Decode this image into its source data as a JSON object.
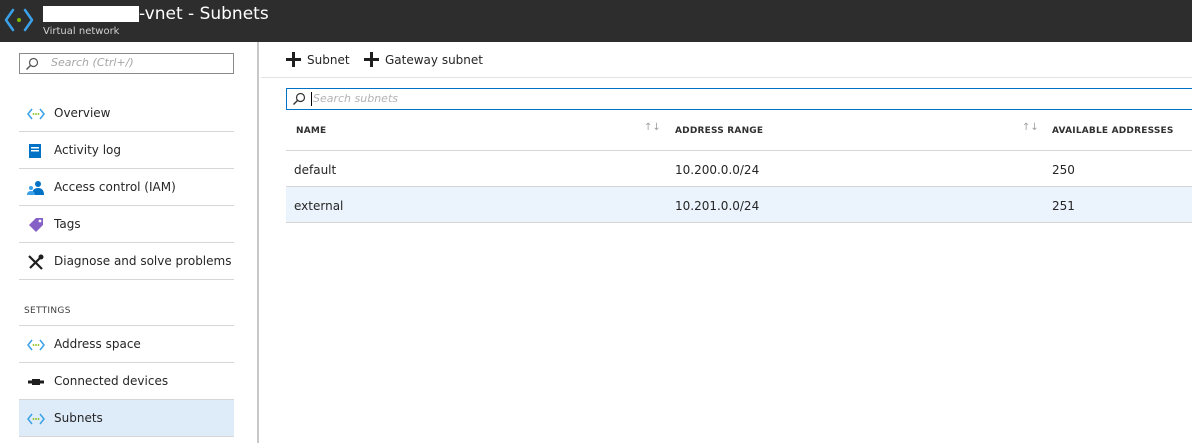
{
  "header": {
    "title": "-vnet - Subnets",
    "subtitle": "Virtual network",
    "icon": "virtual-network-icon"
  },
  "sidebar": {
    "search_placeholder": "Search (Ctrl+/)",
    "items": [
      {
        "label": "Overview",
        "icon": "overview-icon"
      },
      {
        "label": "Activity log",
        "icon": "activity-log-icon"
      },
      {
        "label": "Access control (IAM)",
        "icon": "access-control-icon"
      },
      {
        "label": "Tags",
        "icon": "tag-icon"
      },
      {
        "label": "Diagnose and solve problems",
        "icon": "wrench-icon"
      }
    ],
    "section_label": "SETTINGS",
    "settings_items": [
      {
        "label": "Address space",
        "icon": "address-space-icon"
      },
      {
        "label": "Connected devices",
        "icon": "connected-devices-icon"
      },
      {
        "label": "Subnets",
        "icon": "subnets-icon",
        "active": true
      }
    ]
  },
  "toolbar": {
    "add_subnet_label": "Subnet",
    "add_gateway_subnet_label": "Gateway subnet"
  },
  "filter": {
    "placeholder": "Search subnets"
  },
  "table": {
    "columns": [
      "NAME",
      "ADDRESS RANGE",
      "AVAILABLE ADDRESSES"
    ],
    "rows": [
      {
        "name": "default",
        "address_range": "10.200.0.0/24",
        "available": "250"
      },
      {
        "name": "external",
        "address_range": "10.201.0.0/24",
        "available": "251"
      }
    ]
  },
  "colors": {
    "header_bg": "#2d2d2d",
    "accent": "#0072c6",
    "selected_bg": "#deecf9",
    "icon_green": "#7fba00",
    "icon_blue": "#0072c6"
  }
}
